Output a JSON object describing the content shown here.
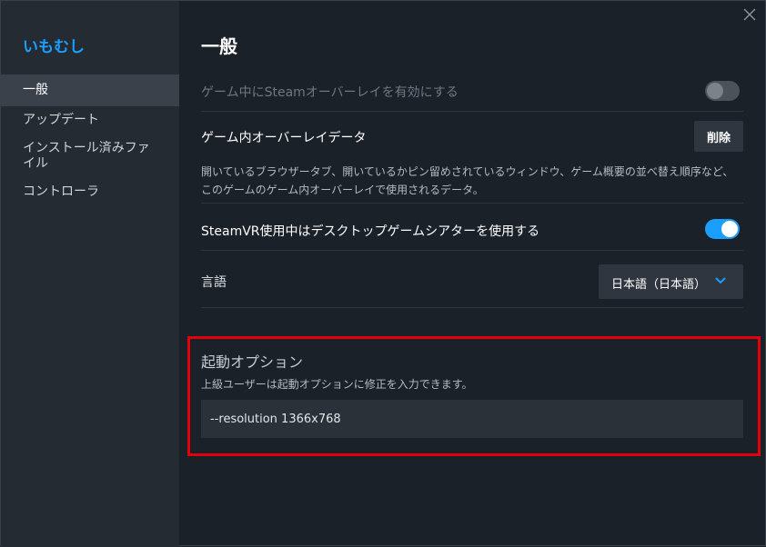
{
  "sidebar": {
    "game_title": "いもむし",
    "items": [
      {
        "label": "一般"
      },
      {
        "label": "アップデート"
      },
      {
        "label": "インストール済みファイル"
      },
      {
        "label": "コントローラ"
      }
    ]
  },
  "main": {
    "title": "一般",
    "overlay_toggle_label": "ゲーム中にSteamオーバーレイを有効にする",
    "overlay_data_label": "ゲーム内オーバーレイデータ",
    "delete_button": "削除",
    "overlay_data_desc": "開いているブラウザータブ、開いているかピン留めされているウィンドウ、ゲーム概要の並べ替え順序など、このゲームのゲーム内オーバーレイで使用されるデータ。",
    "steamvr_label": "SteamVR使用中はデスクトップゲームシアターを使用する",
    "language_label": "言語",
    "language_value": "日本語（日本語）",
    "launch_title": "起動オプション",
    "launch_desc": "上級ユーザーは起動オプションに修正を入力できます。",
    "launch_value": "--resolution 1366x768"
  },
  "toggles": {
    "overlay_enabled": false,
    "steamvr_theater": true
  },
  "icons": {
    "close": "close-icon",
    "chevron": "chevron-down-icon"
  },
  "colors": {
    "accent": "#1a9fff",
    "highlight_box": "#e3000b"
  }
}
